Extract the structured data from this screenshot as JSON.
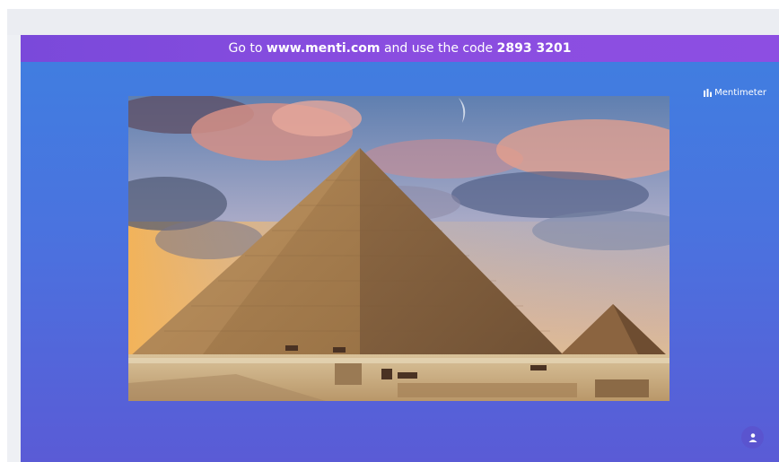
{
  "banner": {
    "prefix": "Go to ",
    "url": "www.menti.com",
    "middle": " and use the code ",
    "code": "2893 3201"
  },
  "brand": {
    "name": "Mentimeter",
    "icon": "mentimeter-logo-icon"
  },
  "slide": {
    "image": "pyramid-photo"
  },
  "participant_button": {
    "icon": "person-icon"
  },
  "colors": {
    "banner": "#8a4de0",
    "stage_top": "#3f7fe0",
    "stage_bottom": "#5a5bd6",
    "text": "#ffffff"
  }
}
